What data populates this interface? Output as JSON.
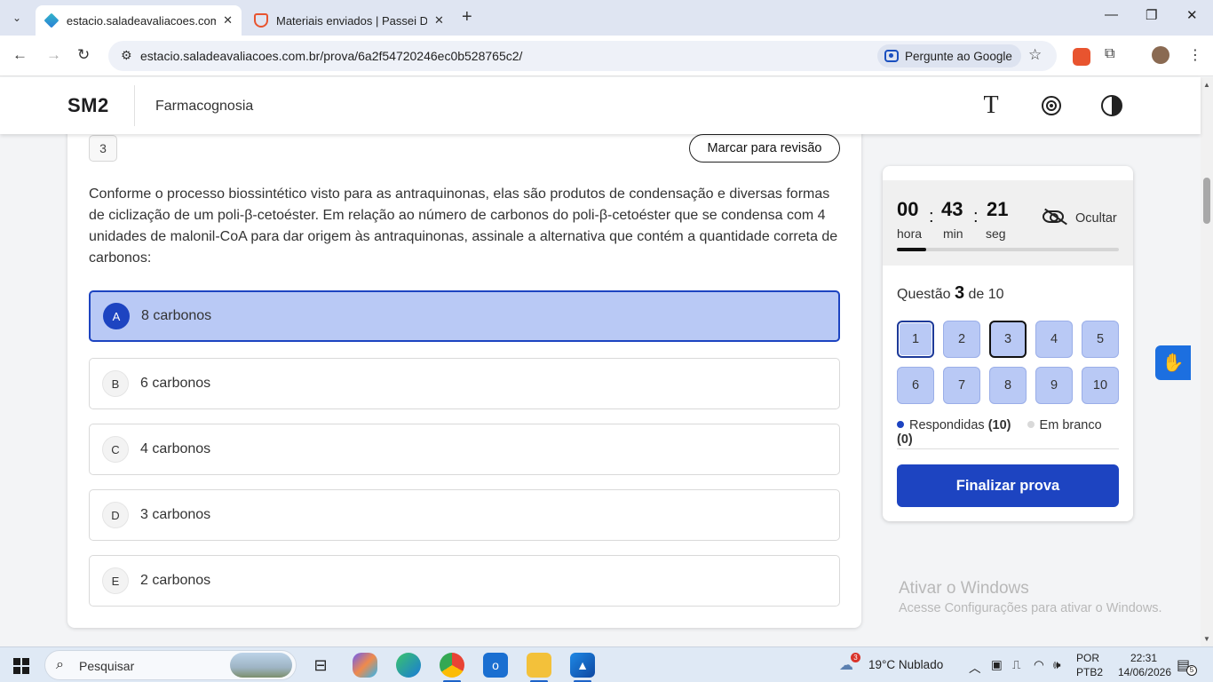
{
  "browser": {
    "tabs": [
      {
        "title": "estacio.saladeavaliacoes.com.br",
        "active": true
      },
      {
        "title": "Materiais enviados | Passei Direto",
        "active": false
      }
    ],
    "url": "estacio.saladeavaliacoes.com.br/prova/6a2f54720246ec0b528765c2/",
    "ask_google": "Pergunte ao Google"
  },
  "header": {
    "logo": "SM2",
    "course": "Farmacognosia",
    "font_icon": "T"
  },
  "question": {
    "number": "3",
    "review_label": "Marcar para revisão",
    "text": "Conforme o processo biossintético visto para as antraquinonas, elas são produtos de condensação e diversas formas de ciclização de um poli-β-cetoéster. Em relação ao número de carbonos do poli-β-cetoéster que se condensa com 4 unidades de malonil-CoA para dar origem às antraquinonas, assinale a alternativa que contém a quantidade correta de carbonos:",
    "options": [
      {
        "letter": "A",
        "text": "8 carbonos",
        "selected": true
      },
      {
        "letter": "B",
        "text": "6 carbonos",
        "selected": false
      },
      {
        "letter": "C",
        "text": "4 carbonos",
        "selected": false
      },
      {
        "letter": "D",
        "text": "3 carbonos",
        "selected": false
      },
      {
        "letter": "E",
        "text": "2 carbonos",
        "selected": false
      }
    ]
  },
  "timer": {
    "hours": "00",
    "minutes": "43",
    "seconds": "21",
    "hours_label": "hora",
    "minutes_label": "min",
    "seconds_label": "seg",
    "separator": ":",
    "hide_label": "Ocultar",
    "progress_fraction": 0.13
  },
  "navigator": {
    "prefix": "Questão",
    "current": "3",
    "suffix": "de 10",
    "buttons": [
      "1",
      "2",
      "3",
      "4",
      "5",
      "6",
      "7",
      "8",
      "9",
      "10"
    ],
    "answered_label": "Respondidas",
    "answered_count": "(10)",
    "blank_label": "Em branco",
    "blank_count": "(0)",
    "finish_label": "Finalizar prova"
  },
  "watermark": {
    "line1": "Ativar o Windows",
    "line2": "Acesse Configurações para ativar o Windows."
  },
  "taskbar": {
    "search_placeholder": "Pesquisar",
    "weather_badge": "3",
    "weather": "19°C  Nublado",
    "lang1": "POR",
    "lang2": "PTB2",
    "time": "22:31",
    "date": "14/06/2026",
    "notif_count": "5"
  },
  "colors": {
    "accent": "#1d44c1",
    "selected_bg": "#b9c9f5",
    "answered_dot": "#1d44c1",
    "blank_dot": "#d9d9d9"
  }
}
